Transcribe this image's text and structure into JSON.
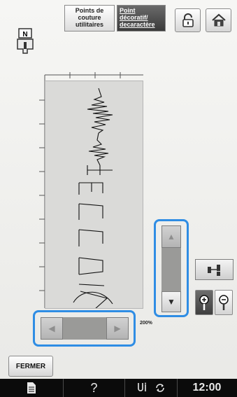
{
  "header": {
    "tab_utility_label": "Points de\ncouture\nutilitaires",
    "tab_decor_label": "Point\ndécoratif/\ndecaractère"
  },
  "preview": {
    "zoom_label": "200%"
  },
  "controls": {
    "up_arrow": "▲",
    "down_arrow": "▼",
    "left_arrow": "◀",
    "right_arrow": "▶"
  },
  "footer": {
    "close_label": "FERMER"
  },
  "status_bar": {
    "help_label": "?",
    "time": "12:00"
  },
  "colors": {
    "highlight": "#2f8de4",
    "status_bar_bg": "#0b0b0b"
  },
  "icons": [
    "presser-foot-icon",
    "lock-icon",
    "home-icon",
    "move-pattern-icon",
    "zoom-in-icon",
    "zoom-out-icon",
    "document-icon",
    "thread-icon",
    "rotate-icon"
  ]
}
